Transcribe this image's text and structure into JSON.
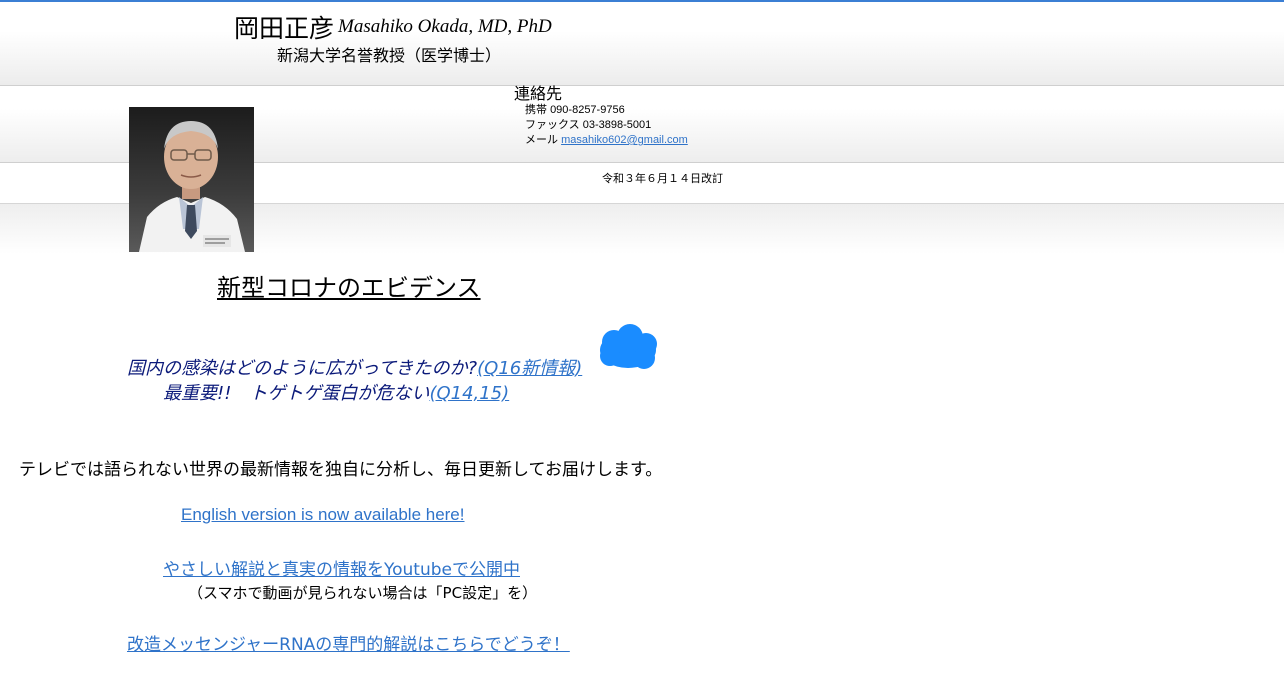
{
  "header": {
    "name_jp": "岡田正彦",
    "name_en": "Masahiko Okada, MD, PhD",
    "affiliation": "新潟大学名誉教授（医学博士）"
  },
  "contact": {
    "heading": "連絡先",
    "mobile_label": "携帯",
    "mobile": "090-8257-9756",
    "fax_label": "ファックス",
    "fax": "03-3898-5001",
    "email_label": "メール",
    "email": "masahiko602@gmail.com"
  },
  "revised": "令和３年６月１４日改訂",
  "main": {
    "title": "新型コロナのエビデンス",
    "question1_text": "国内の感染はどのように広がってきたのか?",
    "question1_link": "(Q16新情報)",
    "question2_text": "最重要!!　トゲトゲ蛋白が危ない",
    "question2_link": "(Q14,15)",
    "tagline": "テレビでは語られない世界の最新情報を独自に分析し、毎日更新してお届けします。",
    "english_link": "English version is now available here!",
    "youtube_link": "やさしい解説と真実の情報をYoutubeで公開中",
    "smartphone_note": "（スマホで動画が見られない場合は「PC設定」を）",
    "mrna_link": "改造メッセンジャーRNAの専門的解説はこちらでどうぞ！"
  },
  "colors": {
    "link": "#2f73c9",
    "question_text": "#0b1a7a",
    "cloud": "#1a8cff",
    "top_border": "#3b7fd4"
  }
}
